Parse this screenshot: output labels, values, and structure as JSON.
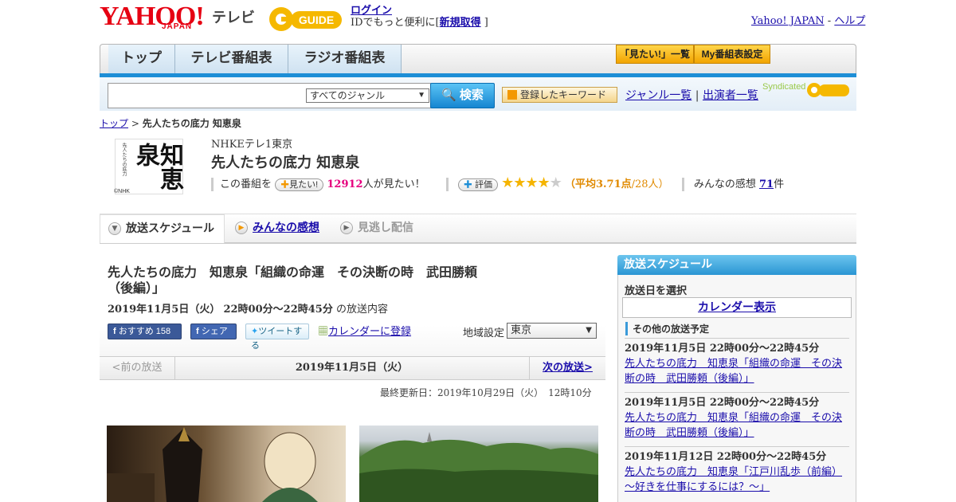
{
  "header": {
    "logo": "YAHOO!",
    "logo_sub": "JAPAN",
    "tv_label": "テレビ",
    "gguide_label": "GUIDE",
    "login": "ログイン",
    "login_desc": "IDでもっと便利に[",
    "signup": "新規取得",
    "login_desc_end": "]",
    "yahoo_japan": "Yahoo! JAPAN",
    "dash": "-",
    "help": "ヘルプ"
  },
  "nav": {
    "tabs": [
      "トップ",
      "テレビ番組表",
      "ラジオ番組表"
    ],
    "mitai_list": "「見たい!」一覧",
    "my_schedule": "My番組表設定"
  },
  "search": {
    "genre": "すべてのジャンル",
    "button": "検索",
    "keyword_btn": "登録したキーワード",
    "genre_list": "ジャンル一覧",
    "separator": "|",
    "performer_list": "出演者一覧",
    "syndicated": "Syndicated"
  },
  "breadcrumb": {
    "top": "トップ",
    "sep": ">",
    "current": "先人たちの底力 知恵泉"
  },
  "program": {
    "channel": "NHKEテレ1東京",
    "title": "先人たちの底力 知恵泉",
    "logo_text": "知恵泉",
    "logo_small": "先人たちの底力",
    "nhk_mark": "©NHK",
    "this_program": "この番組を",
    "mitai_pill": "見たい!",
    "mitai_count": "12912",
    "mitai_suffix": "人が見たい！",
    "rate_btn": "評価",
    "rating_avg_prefix": "（平均",
    "rating_avg": "3.71点",
    "rating_count": "/28人）",
    "rating_value": 3.71,
    "impressions_prefix": "みんなの感想",
    "impressions_count": "71",
    "impressions_suffix": "件"
  },
  "tabs": {
    "schedule": "放送スケジュール",
    "impressions": "みんなの感想",
    "missed": "見逃し配信"
  },
  "episode": {
    "title": "先人たちの底力　知恵泉「組織の命運　その決断の時　武田勝頼（後編）」",
    "date": "2019年11月5日（火）",
    "time": "22時00分～22時45分",
    "date_suffix": "の放送内容",
    "fb_recommend": "おすすめ",
    "fb_count": "158",
    "fb_share": "シェア",
    "tweet": "ツイートする",
    "calendar": "カレンダーに登録",
    "region_label": "地域設定",
    "region": "東京",
    "prev": "<前の放送",
    "current_date": "2019年11月5日（火）",
    "next": "次の放送>",
    "updated": "最終更新日：2019年10月29日（火）　12時10分"
  },
  "sidebar": {
    "header": "放送スケジュール",
    "select_date": "放送日を選択",
    "calendar_btn": "カレンダー表示",
    "other": "その他の放送予定",
    "items": [
      {
        "date": "2019年11月5日 22時00分～22時45分",
        "title": "先人たちの底力　知恵泉「組織の命運　その決断の時　武田勝頼（後編）」"
      },
      {
        "date": "2019年11月5日 22時00分～22時45分",
        "title": "先人たちの底力　知恵泉「組織の命運　その決断の時　武田勝頼（後編）」"
      },
      {
        "date": "2019年11月12日 22時00分～22時45分",
        "title": "先人たちの底力　知恵泉「江戸川乱歩（前編）～好きを仕事にするには？～」"
      }
    ]
  },
  "colors": {
    "accent_blue": "#1d8ed6",
    "yahoo_red": "#e60012",
    "mitai_pink": "#e6007e",
    "rating_orange": "#e08a00"
  }
}
